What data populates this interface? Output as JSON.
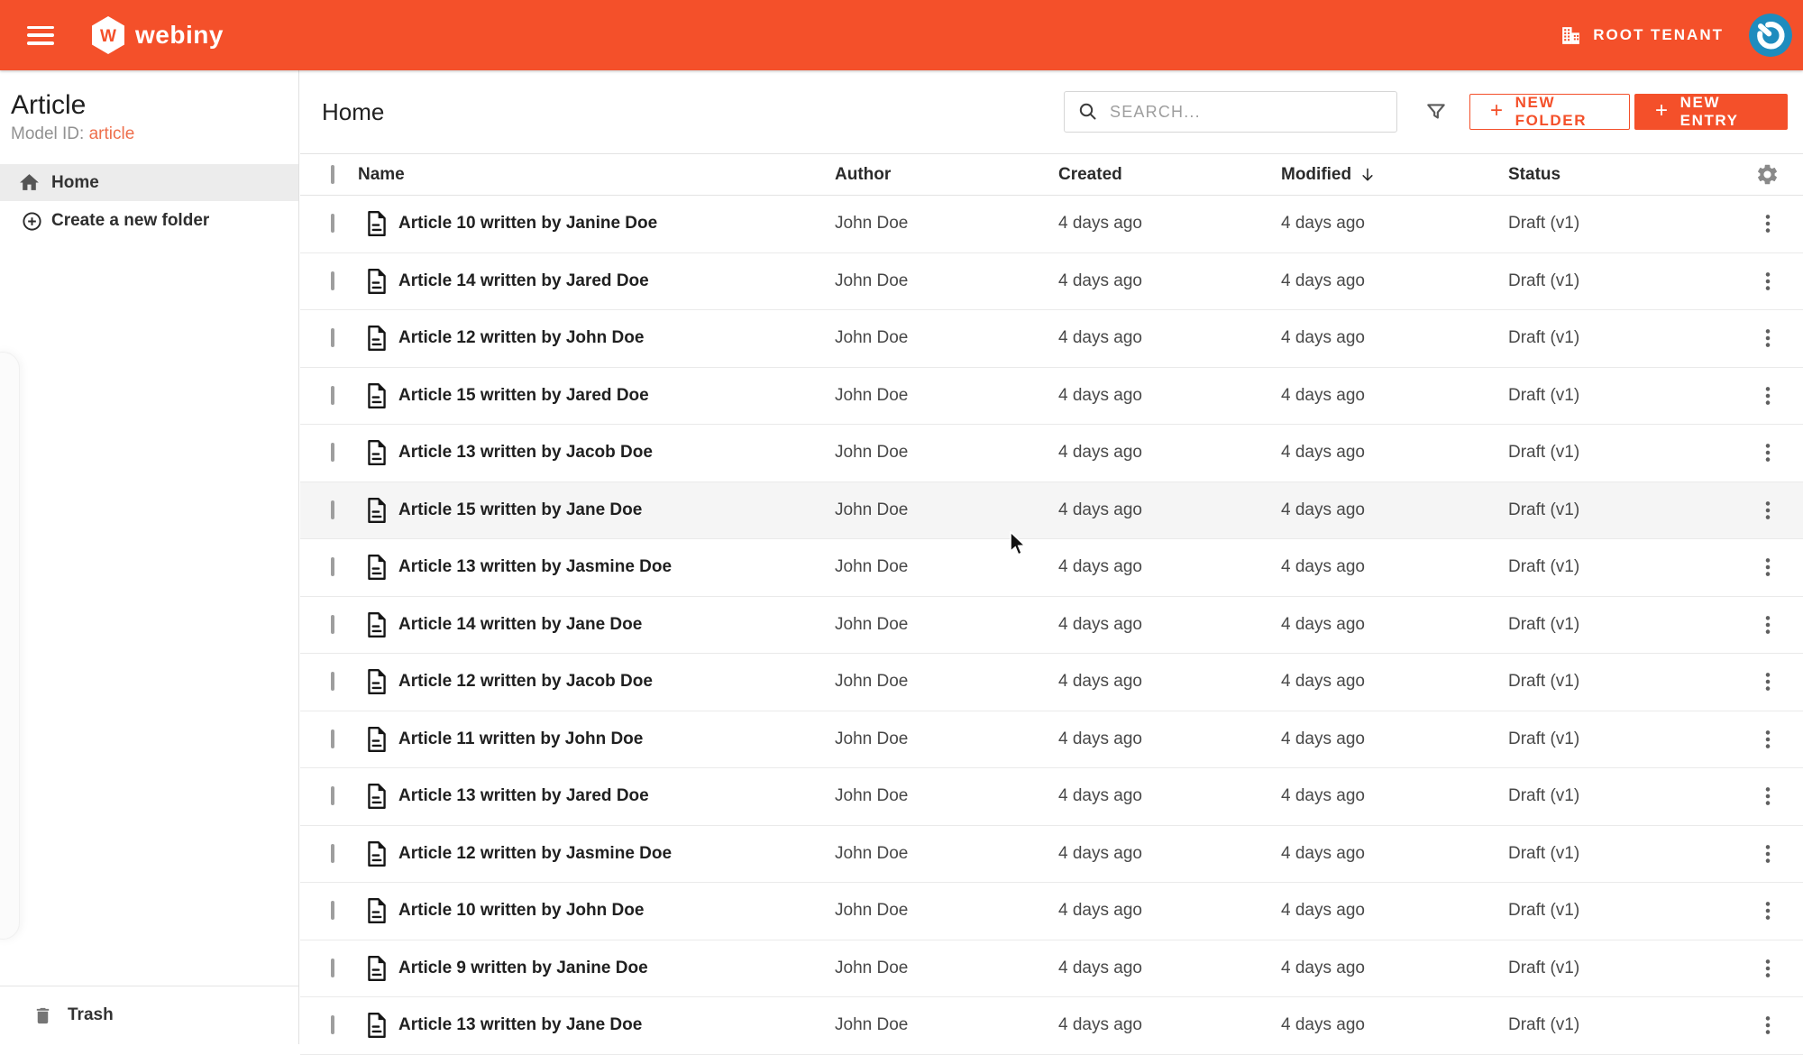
{
  "topbar": {
    "brand": "webiny",
    "tenant_label": "ROOT TENANT"
  },
  "sidebar": {
    "title": "Article",
    "model_id_label": "Model ID:",
    "model_id_value": "article",
    "home_label": "Home",
    "create_folder_label": "Create a new folder",
    "trash_label": "Trash"
  },
  "toolbar": {
    "title": "Home",
    "search_placeholder": "SEARCH...",
    "new_folder_label": "NEW FOLDER",
    "new_entry_label": "NEW ENTRY",
    "plus": "+"
  },
  "table": {
    "columns": [
      "Name",
      "Author",
      "Created",
      "Modified",
      "Status"
    ],
    "sort": {
      "column": "Modified",
      "direction": "desc"
    },
    "rows": [
      {
        "name": "Article 10 written by Janine Doe",
        "author": "John Doe",
        "created": "4 days ago",
        "modified": "4 days ago",
        "status": "Draft (v1)",
        "hovered": false
      },
      {
        "name": "Article 14 written by Jared Doe",
        "author": "John Doe",
        "created": "4 days ago",
        "modified": "4 days ago",
        "status": "Draft (v1)",
        "hovered": false
      },
      {
        "name": "Article 12 written by John Doe",
        "author": "John Doe",
        "created": "4 days ago",
        "modified": "4 days ago",
        "status": "Draft (v1)",
        "hovered": false
      },
      {
        "name": "Article 15 written by Jared Doe",
        "author": "John Doe",
        "created": "4 days ago",
        "modified": "4 days ago",
        "status": "Draft (v1)",
        "hovered": false
      },
      {
        "name": "Article 13 written by Jacob Doe",
        "author": "John Doe",
        "created": "4 days ago",
        "modified": "4 days ago",
        "status": "Draft (v1)",
        "hovered": false
      },
      {
        "name": "Article 15 written by Jane Doe",
        "author": "John Doe",
        "created": "4 days ago",
        "modified": "4 days ago",
        "status": "Draft (v1)",
        "hovered": true
      },
      {
        "name": "Article 13 written by Jasmine Doe",
        "author": "John Doe",
        "created": "4 days ago",
        "modified": "4 days ago",
        "status": "Draft (v1)",
        "hovered": false
      },
      {
        "name": "Article 14 written by Jane Doe",
        "author": "John Doe",
        "created": "4 days ago",
        "modified": "4 days ago",
        "status": "Draft (v1)",
        "hovered": false
      },
      {
        "name": "Article 12 written by Jacob Doe",
        "author": "John Doe",
        "created": "4 days ago",
        "modified": "4 days ago",
        "status": "Draft (v1)",
        "hovered": false
      },
      {
        "name": "Article 11 written by John Doe",
        "author": "John Doe",
        "created": "4 days ago",
        "modified": "4 days ago",
        "status": "Draft (v1)",
        "hovered": false
      },
      {
        "name": "Article 13 written by Jared Doe",
        "author": "John Doe",
        "created": "4 days ago",
        "modified": "4 days ago",
        "status": "Draft (v1)",
        "hovered": false
      },
      {
        "name": "Article 12 written by Jasmine Doe",
        "author": "John Doe",
        "created": "4 days ago",
        "modified": "4 days ago",
        "status": "Draft (v1)",
        "hovered": false
      },
      {
        "name": "Article 10 written by John Doe",
        "author": "John Doe",
        "created": "4 days ago",
        "modified": "4 days ago",
        "status": "Draft (v1)",
        "hovered": false
      },
      {
        "name": "Article 9 written by Janine Doe",
        "author": "John Doe",
        "created": "4 days ago",
        "modified": "4 days ago",
        "status": "Draft (v1)",
        "hovered": false
      },
      {
        "name": "Article 13 written by Jane Doe",
        "author": "John Doe",
        "created": "4 days ago",
        "modified": "4 days ago",
        "status": "Draft (v1)",
        "hovered": false
      }
    ]
  },
  "icons": {
    "topbar": [
      "hamburger-icon",
      "webiny-logo",
      "building-icon",
      "avatar"
    ],
    "table": [
      "document-icon",
      "kebab-menu-icon",
      "gear-icon",
      "sort-desc-icon"
    ]
  },
  "colors": {
    "accent": "#f4502a",
    "model_id_accent": "#ee6f4c",
    "avatar_blue": "#1e8cbe",
    "hover_row": "#f5f5f5"
  }
}
